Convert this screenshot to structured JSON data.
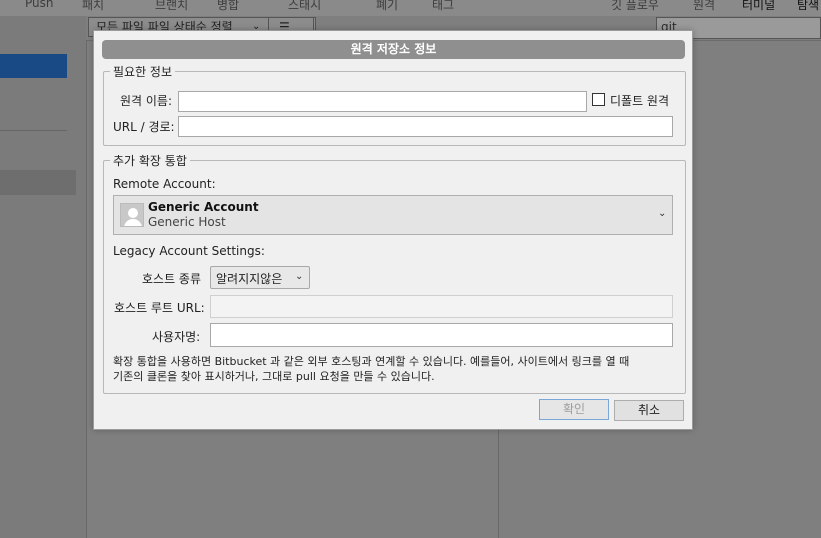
{
  "background": {
    "toolbar": [
      "Push",
      "패치",
      "브랜치",
      "병합",
      "스태시",
      "폐기",
      "태그",
      "깃 플로우",
      "원격",
      "터미널",
      "탐색"
    ],
    "file_filter": "모든 파일  파일 상태순 정렬",
    "search": "git"
  },
  "dialog": {
    "title": "원격 저장소 정보",
    "required_group": {
      "legend": "필요한 정보",
      "remote_name_label": "원격 이름:",
      "remote_name_value": "",
      "default_remote_label": "디폴트 원격",
      "default_remote_checked": false,
      "url_label": "URL / 경로:",
      "url_value": ""
    },
    "integration_group": {
      "legend": "추가 확장 통합",
      "remote_account_label": "Remote Account:",
      "account_name": "Generic Account",
      "account_host": "Generic Host",
      "legacy_label": "Legacy Account Settings:",
      "host_type_label": "호스트 종류",
      "host_type_value": "알려지지않은",
      "host_root_label": "호스트 루트 URL:",
      "host_root_value": "",
      "username_label": "사용자명:",
      "username_value": "",
      "note_line1": "확장 통합을 사용하면 Bitbucket 과 같은 외부 호스팅과 연계할 수 있습니다. 예를들어, 사이트에서 링크를 열 때",
      "note_line2": "기존의 클론을 찾아 표시하거나, 그대로 pull 요청을 만들 수 있습니다."
    },
    "buttons": {
      "ok": "확인",
      "cancel": "취소"
    }
  },
  "icons": {
    "avatar": "user-avatar-icon",
    "dropdown": "chevron-down-icon",
    "list": "list-icon"
  }
}
